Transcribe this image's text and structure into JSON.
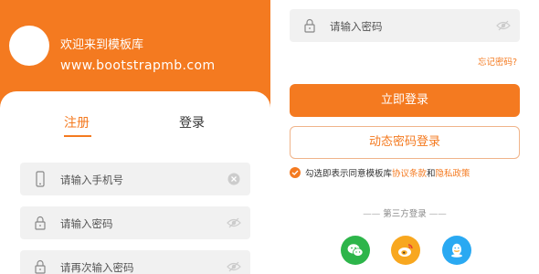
{
  "header": {
    "welcome": "欢迎来到模板库",
    "url": "www.bootstrapmb.com"
  },
  "tabs": [
    {
      "label": "注册",
      "active": true
    },
    {
      "label": "登录",
      "active": false
    }
  ],
  "register_form": {
    "phone_placeholder": "请输入手机号",
    "password_placeholder": "请输入密码",
    "confirm_placeholder": "请再次输入密码"
  },
  "login_form": {
    "password_placeholder": "请输入密码",
    "forgot_label": "忘记密码?",
    "login_button": "立即登录",
    "dynamic_button": "动态密码登录",
    "agree_prefix": "勾选即表示同意模板库",
    "agreement_link": "协议条款",
    "agree_and": "和",
    "privacy_link": "隐私政策",
    "third_party_label": "第三方登录",
    "third_party_dash": "——"
  },
  "social_icons": [
    "wechat-icon",
    "weibo-icon",
    "qq-icon"
  ],
  "colors": {
    "brand": "#f47a20",
    "field_bg": "#f1f1f1",
    "wechat": "#2db54a",
    "weibo": "#f8a71f",
    "qq": "#2aa9f2"
  }
}
